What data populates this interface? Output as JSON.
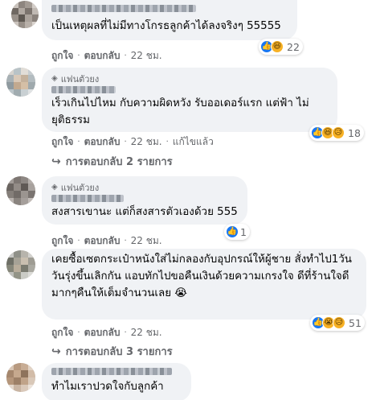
{
  "comments": [
    {
      "text": "เป็นเหตุผลที่ไม่มีทางโกรธลูกค้าได้ลงจริงๆ 55555",
      "fan_badge": "",
      "reaction_count": "22",
      "like": "ถูกใจ",
      "reply": "ตอบกลับ",
      "time": "22 ชม."
    },
    {
      "text": "เร็วเกินไปไหม กับความผิดหวัง รับออเดอร์แรก แต่ฟ้า ไม่ยุติธรรม",
      "fan_badge": "แฟนตัวยง",
      "reaction_count": "18",
      "like": "ถูกใจ",
      "reply": "ตอบกลับ",
      "time": "22 ชม.",
      "edited": "แก้ไขแล้ว",
      "view_replies": "การตอบกลับ 2 รายการ"
    },
    {
      "text": "สงสารเขานะ แต่ก็สงสารตัวเองด้วย 555",
      "fan_badge": "แฟนตัวยง",
      "reaction_count": "1",
      "like": "ถูกใจ",
      "reply": "ตอบกลับ",
      "time": "22 ชม."
    },
    {
      "text": "เคยซื้อเซตกระเป๋าหนังใส่ไม่กลองกับอุปกรณ์ให้ผู้ชาย สั่งทำไป1วันวันรุ่งขึ้นเลิกกัน แอบทักไปขอคืนเงินด้วยความเกรงใจ ดีที่ร้านใจดีมากๆคืนให้เต็มจำนวนเลย 😭",
      "fan_badge": "",
      "reaction_count": "51",
      "like": "ถูกใจ",
      "reply": "ตอบกลับ",
      "time": "22 ชม.",
      "view_replies": "การตอบกลับ 3 รายการ"
    },
    {
      "text": "ทำไมเราปวดใจกับลูกค้า",
      "fan_badge": ""
    }
  ],
  "icons": {
    "fan": "diamond-icon",
    "like": "thumbs-up-icon",
    "haha": "laughing-face-icon",
    "sad": "sad-face-icon",
    "reply_arrow": "reply-arrow-icon"
  },
  "colors": {
    "bubble": "#f0f2f5",
    "meta": "#65676b",
    "like_blue": "#1877f2",
    "emoji_yellow": "#f7b125"
  }
}
